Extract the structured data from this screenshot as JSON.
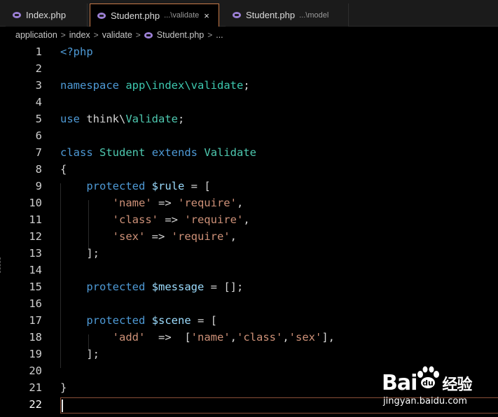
{
  "tabs": [
    {
      "name": "Index.php",
      "dir": ""
    },
    {
      "name": "Student.php",
      "dir": "...\\validate",
      "close": "×"
    },
    {
      "name": "Student.php",
      "dir": "...\\model"
    }
  ],
  "breadcrumb": {
    "items": [
      "application",
      "index",
      "validate",
      "Student.php",
      "..."
    ],
    "separator": ">"
  },
  "line_numbers": [
    "1",
    "2",
    "3",
    "4",
    "5",
    "6",
    "7",
    "8",
    "9",
    "10",
    "11",
    "12",
    "13",
    "14",
    "15",
    "16",
    "17",
    "18",
    "19",
    "20",
    "21",
    "22"
  ],
  "code": {
    "l1_open": "<?php",
    "l3_kw": "namespace",
    "l3_ns": "app\\index\\validate",
    "l3_end": ";",
    "l5_kw": "use",
    "l5_a": "think\\",
    "l5_b": "Validate",
    "l5_end": ";",
    "l7_kw1": "class",
    "l7_cls": "Student",
    "l7_kw2": "extends",
    "l7_cls2": "Validate",
    "l8": "{",
    "l9_kw": "protected",
    "l9_var": "$rule",
    "l9_rest": " = [",
    "l10_key": "'name'",
    "l10_op": " => ",
    "l10_val": "'require'",
    "l10_end": ",",
    "l11_key": "'class'",
    "l11_op": " => ",
    "l11_val": "'require'",
    "l11_end": ",",
    "l12_key": "'sex'",
    "l12_op": " => ",
    "l12_val": "'require'",
    "l12_end": ",",
    "l13": "];",
    "l15_kw": "protected",
    "l15_var": "$message",
    "l15_rest": " = [];",
    "l17_kw": "protected",
    "l17_var": "$scene",
    "l17_rest": " = [",
    "l18_key": "'add'",
    "l18_op": "  =>  [",
    "l18_v1": "'name'",
    "l18_c1": ",",
    "l18_v2": "'class'",
    "l18_c2": ",",
    "l18_v3": "'sex'",
    "l18_end": "],",
    "l19": "];",
    "l21": "}"
  },
  "watermark": {
    "brand": "Bai",
    "brand_suffix": "经验",
    "url": "jingyan.baidu.com"
  },
  "colors": {
    "keyword": "#4e9ad6",
    "class": "#4ec9b0",
    "variable": "#9cdcfe",
    "string": "#ce9178",
    "active_tab_border": "#c77a4a"
  }
}
